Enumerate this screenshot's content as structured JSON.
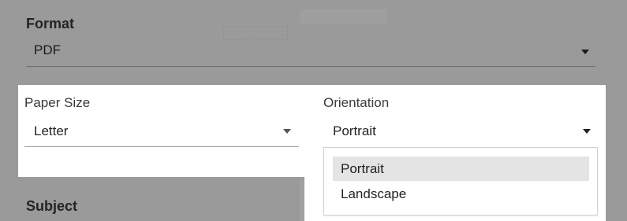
{
  "format": {
    "label": "Format",
    "value": "PDF"
  },
  "paper_size": {
    "label": "Paper Size",
    "value": "Letter"
  },
  "orientation": {
    "label": "Orientation",
    "value": "Portrait",
    "options": [
      {
        "label": "Portrait",
        "selected": true
      },
      {
        "label": "Landscape",
        "selected": false
      }
    ]
  },
  "subject": {
    "label": "Subject"
  },
  "icons": {
    "dropdown": "chevron-down-icon"
  },
  "colors": {
    "overlay_background": "#9a9a9a",
    "panel_background": "#ffffff",
    "selected_option": "#e4e4e4"
  }
}
